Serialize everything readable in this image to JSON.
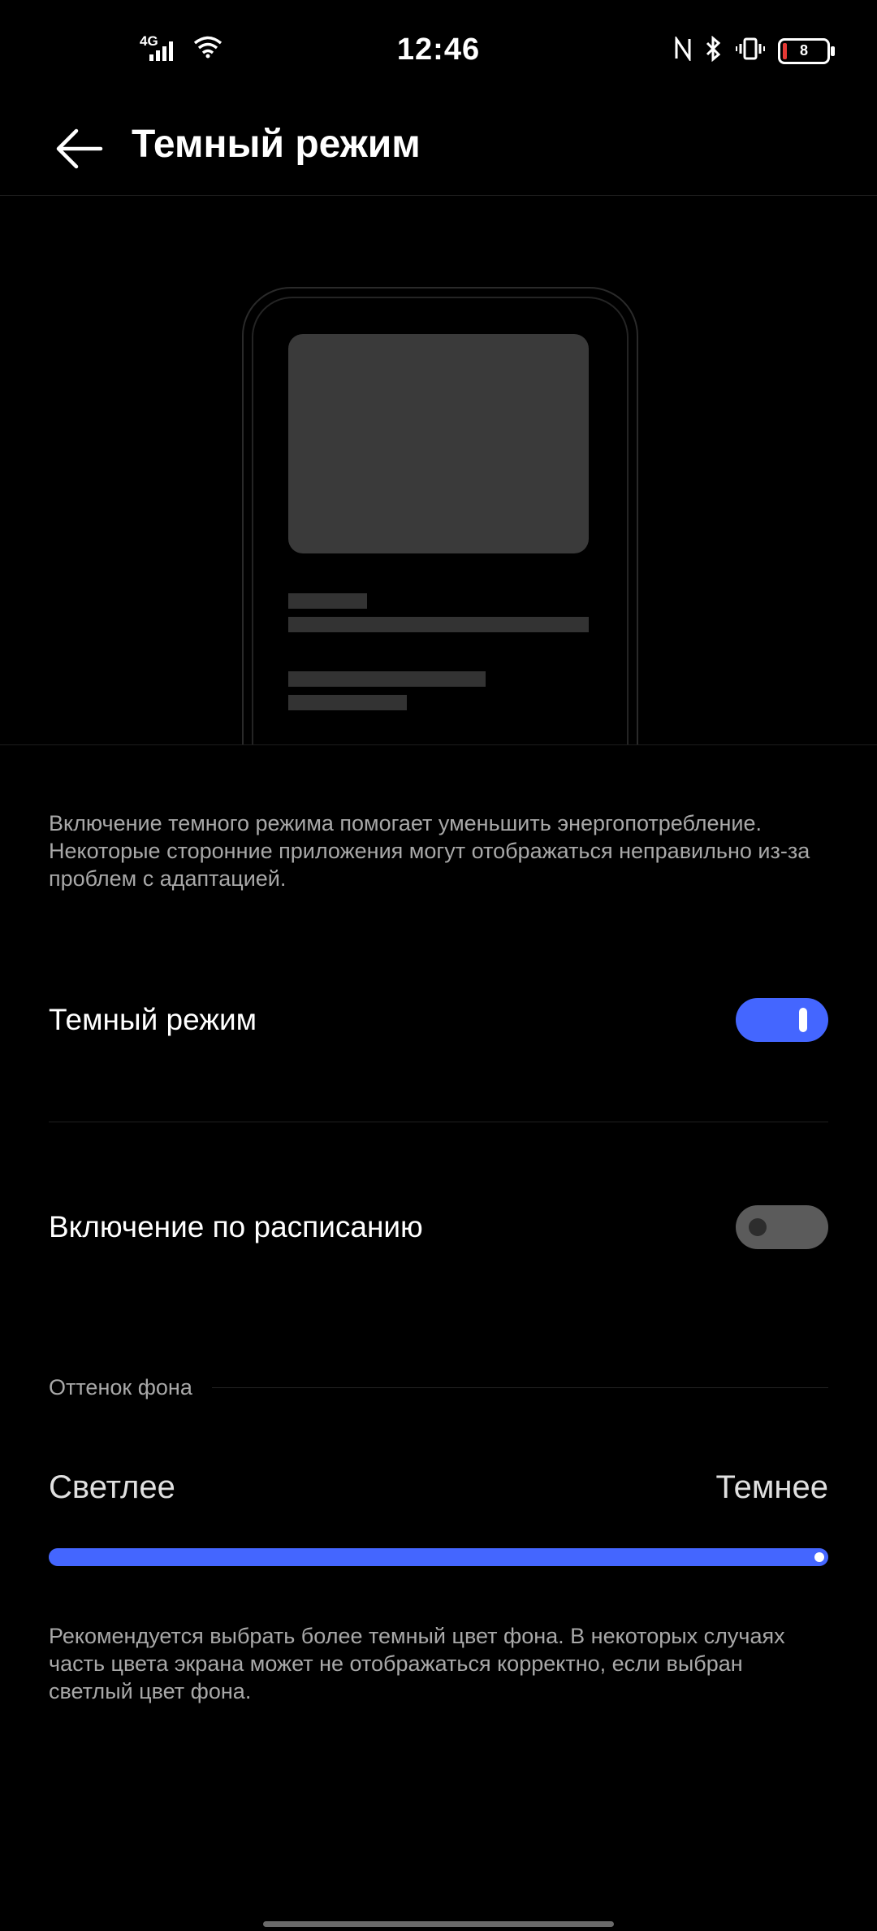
{
  "status_bar": {
    "time": "12:46",
    "network": "4G",
    "battery_level": "8",
    "icons": [
      "signal-icon",
      "wifi-icon",
      "nfc-icon",
      "bluetooth-icon",
      "vibrate-icon",
      "battery-icon"
    ]
  },
  "header": {
    "title": "Темный режим"
  },
  "info_text": "Включение темного режима помогает уменьшить энергопотребление. Некоторые сторонние приложения могут отображаться неправильно из-за проблем с адаптацией.",
  "settings": {
    "dark_mode": {
      "label": "Темный режим",
      "enabled": true
    },
    "schedule": {
      "label": "Включение по расписанию",
      "enabled": false
    }
  },
  "background_tone": {
    "section_label": "Оттенок фона",
    "min_label": "Светлее",
    "max_label": "Темнее",
    "value": 1.0
  },
  "footer_text": "Рекомендуется выбрать более темный цвет фона. В некоторых случаях часть цвета экрана может не отображаться корректно, если выбран светлый цвет фона.",
  "colors": {
    "accent": "#4466ff",
    "background": "#000000",
    "toggle_off": "#5b5b5b"
  }
}
